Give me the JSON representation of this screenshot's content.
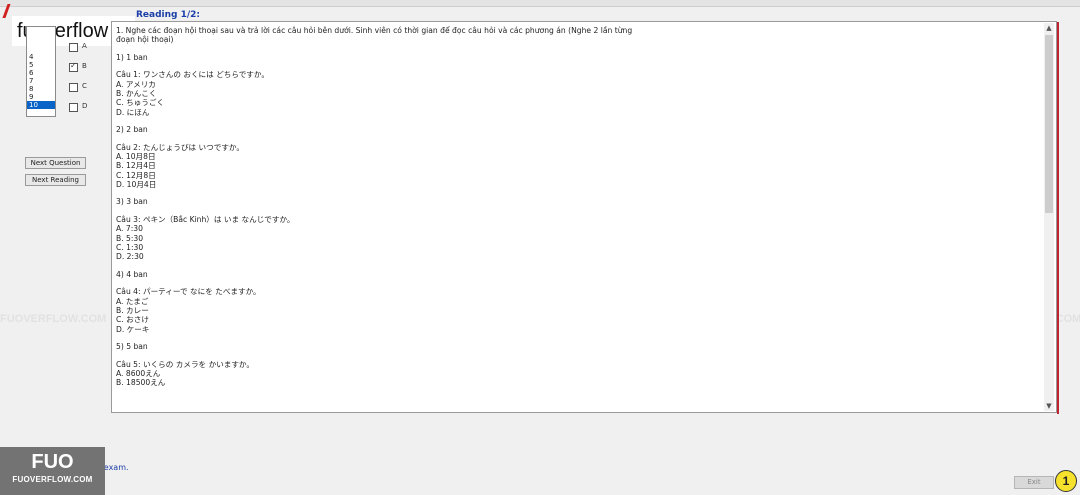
{
  "watermark": {
    "brand": "FUOVERFLOW.COM"
  },
  "header": {
    "logo_text": "fuoverflow",
    "reading_title": "Reading 1/2:"
  },
  "question_list": [
    "4",
    "5",
    "6",
    "7",
    "8",
    "9",
    "10"
  ],
  "options": [
    {
      "label": "A",
      "checked": false
    },
    {
      "label": "B",
      "checked": true
    },
    {
      "label": "C",
      "checked": false
    },
    {
      "label": "D",
      "checked": false
    }
  ],
  "buttons": {
    "next_question": "Next Question",
    "next_reading": "Next Reading",
    "exit": "Exit"
  },
  "content": {
    "intro_line1": "1. Nghe các đoạn hội thoại sau và trả lời các câu hỏi bên dưới. Sinh viên có thời gian để đọc câu hỏi và các phương án (Nghe 2 lần từng",
    "intro_line2": "đoạn hội thoại)",
    "sections": [
      {
        "header": "1) 1 ban",
        "question": "Câu 1:  ワンさんの  おくには  どちらですか。",
        "answers": [
          "A.  アメリカ",
          "B.  かんこく",
          "C.  ちゅうごく",
          "D.  にほん"
        ]
      },
      {
        "header": "2) 2 ban",
        "question": "Câu 2:  たんじょうびは  いつですか。",
        "answers": [
          "A.  10月8日",
          "B.  12月4日",
          "C.  12月8日",
          "D.  10月4日"
        ]
      },
      {
        "header": "3) 3 ban",
        "question": "Câu 3:  ペキン（Bắc Kinh）は  いま  なんじですか。",
        "answers": [
          "A.  7:30",
          "B.  5:30",
          "C.  1:30",
          "D.  2:30"
        ]
      },
      {
        "header": "4) 4 ban",
        "question": "Câu 4:  パーティーで  なにを  たべますか。",
        "answers": [
          "A.  たまご",
          "B.  カレー",
          "C.  おさけ",
          "D.  ケーキ"
        ]
      },
      {
        "header": "5) 5 ban",
        "question": "Câu 5:  いくらの  カメラを  かいますか。",
        "answers": [
          "A.  8600えん",
          "B.  18500えん"
        ]
      }
    ]
  },
  "bottom": {
    "finish_text": "finish the exam."
  },
  "overlay_logo": {
    "big": "FUO",
    "small": "FUOVERFLOW.COM"
  },
  "badge": "1"
}
